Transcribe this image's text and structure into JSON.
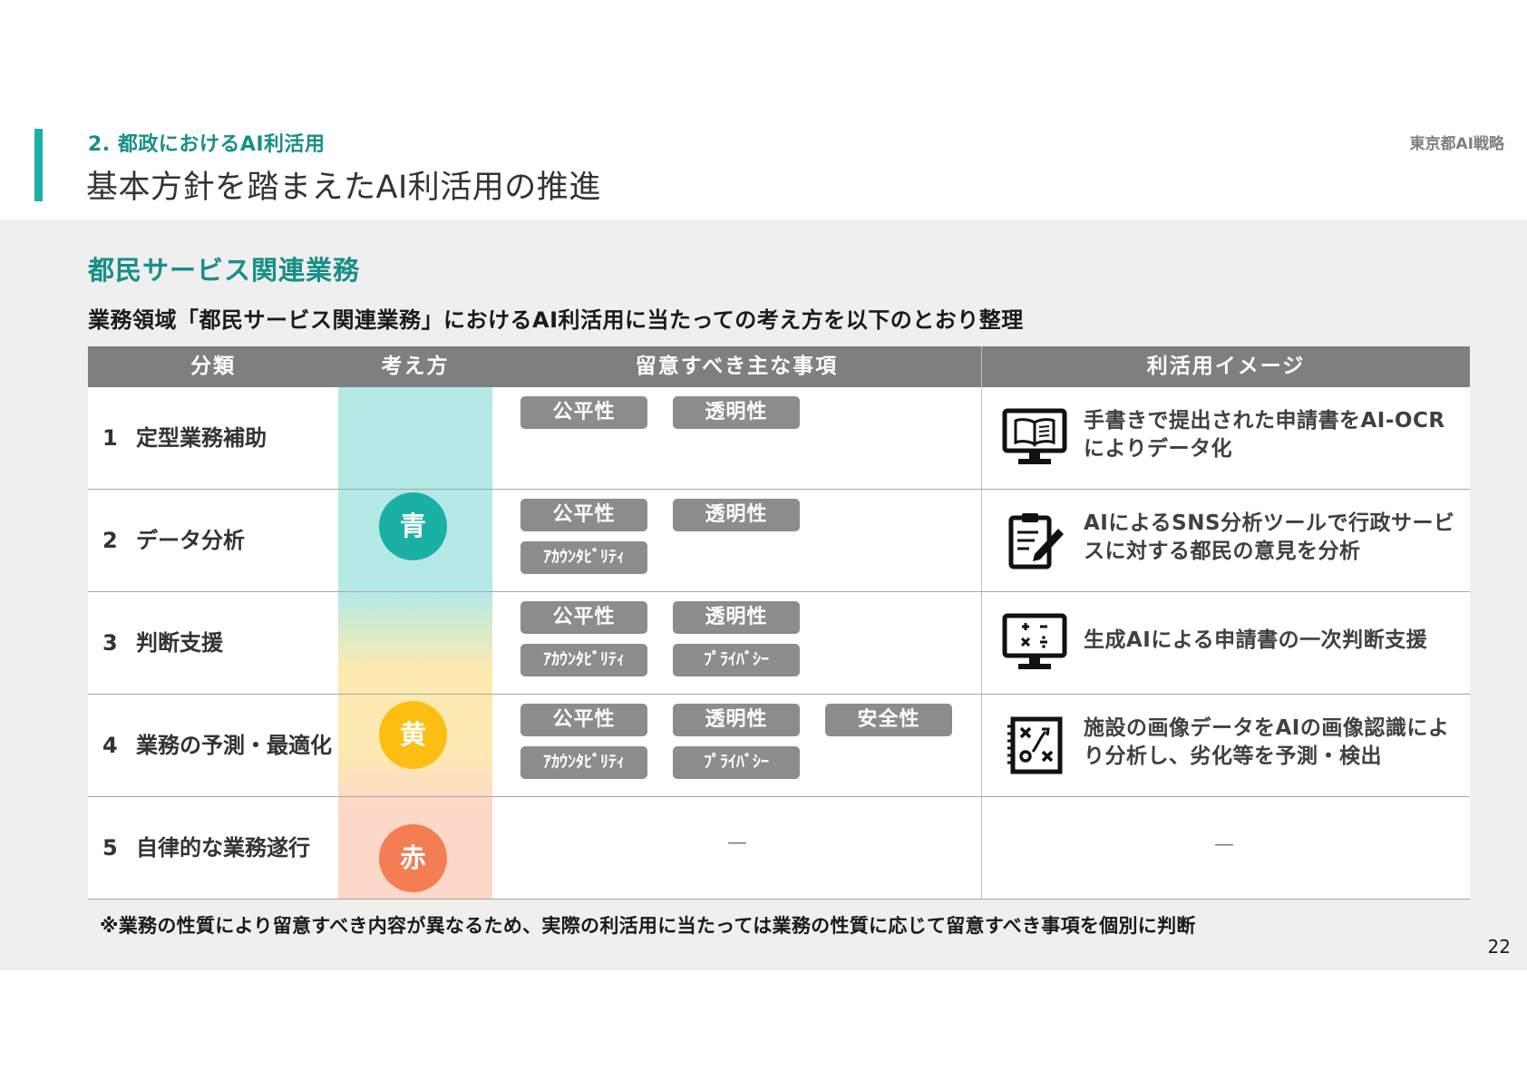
{
  "header": {
    "section_label": "2. 都政におけるAI利活用",
    "title": "基本方針を踏まえたAI利活用の推進",
    "doc_name": "東京都AI戦略"
  },
  "subtitle": "都民サービス関連業務",
  "lead": "業務領域「都民サービス関連業務」におけるAI利活用に当たっての考え方を以下のとおり整理",
  "table": {
    "headers": [
      "分類",
      "考え方",
      "留意すべき主な事項",
      "利活用イメージ"
    ],
    "rows": [
      {
        "num": "1",
        "category": "定型業務補助",
        "tags": [
          "公平性",
          "透明性"
        ],
        "image_text": "手書きで提出された申請書をAI-OCRによりデータ化",
        "icon": "book-monitor-icon"
      },
      {
        "num": "2",
        "category": "データ分析",
        "tags": [
          "公平性",
          "透明性",
          "ｱｶｳﾝﾀﾋﾞﾘﾃｨ"
        ],
        "image_text": "AIによるSNS分析ツールで行政サービスに対する都民の意見を分析",
        "icon": "clipboard-pen-icon"
      },
      {
        "num": "3",
        "category": "判断支援",
        "tags": [
          "公平性",
          "透明性",
          "ｱｶｳﾝﾀﾋﾞﾘﾃｨ",
          "ﾌﾟﾗｲﾊﾞｼｰ"
        ],
        "image_text": "生成AIによる申請書の一次判断支援",
        "icon": "calculator-monitor-icon"
      },
      {
        "num": "4",
        "category": "業務の予測・最適化",
        "tags": [
          "公平性",
          "透明性",
          "安全性",
          "ｱｶｳﾝﾀﾋﾞﾘﾃｨ",
          "ﾌﾟﾗｲﾊﾞｼｰ"
        ],
        "image_text": "施設の画像データをAIの画像認識により分析し、劣化等を予測・検出",
        "icon": "strategy-board-icon"
      },
      {
        "num": "5",
        "category": "自律的な業務遂行",
        "dash_tags": "—",
        "dash_image": "—"
      }
    ],
    "levels": [
      {
        "label": "青",
        "color": "#1bb0a6"
      },
      {
        "label": "黄",
        "color": "#fcbe13"
      },
      {
        "label": "赤",
        "color": "#f47d53"
      }
    ]
  },
  "note": "※業務の性質により留意すべき内容が異なるため、実際の利活用に当たっては業務の性質に応じて留意すべき事項を個別に判断",
  "page_number": "22"
}
